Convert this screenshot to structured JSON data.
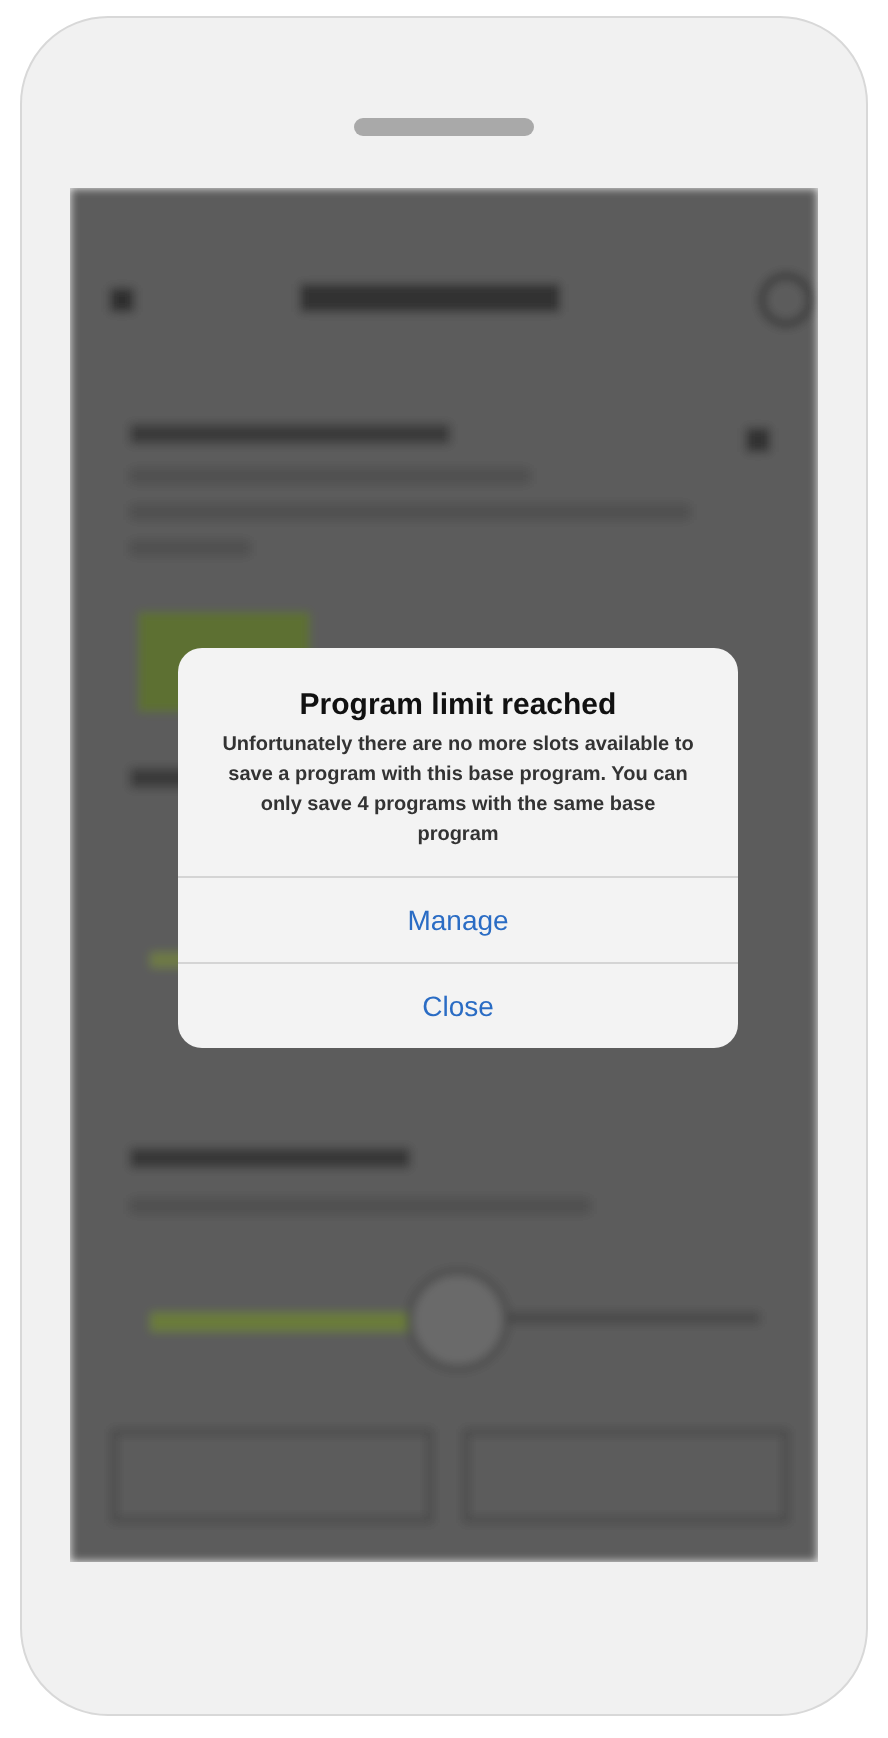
{
  "dialog": {
    "title": "Program limit reached",
    "message": "Unfortunately there are no more slots available to save a program with this base program. You can only save 4 programs with the same base program",
    "actions": [
      {
        "label": "Manage"
      },
      {
        "label": "Close"
      }
    ]
  }
}
